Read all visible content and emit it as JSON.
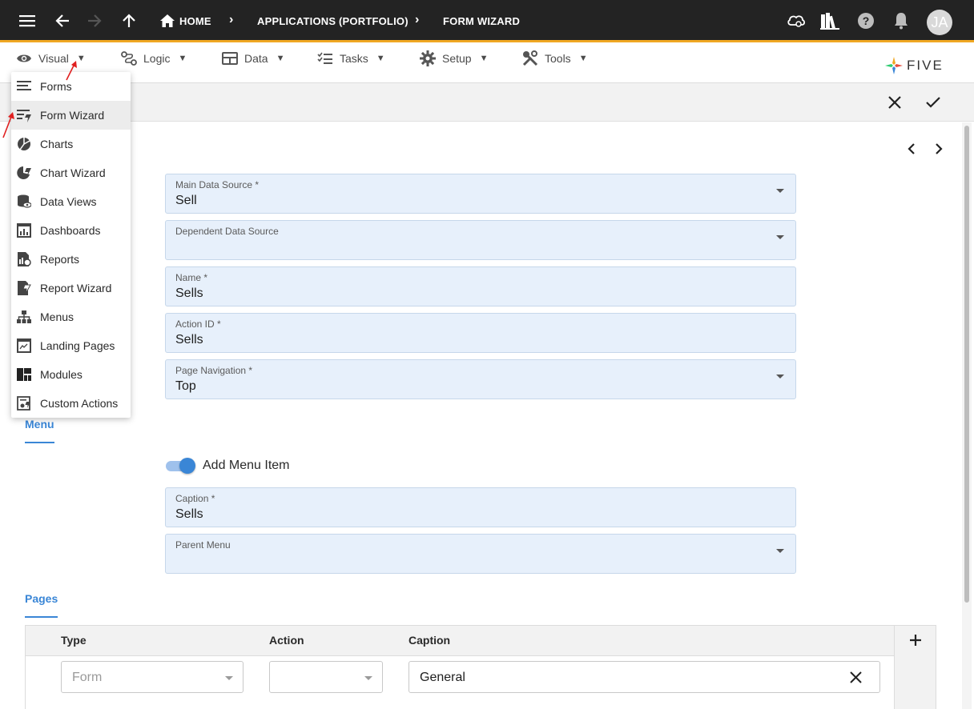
{
  "topbar": {
    "breadcrumbs": [
      "HOME",
      "APPLICATIONS (PORTFOLIO)",
      "FORM WIZARD"
    ],
    "avatar_initials": "JA",
    "icons": [
      "menu-icon",
      "back-arrow-icon",
      "forward-arrow-icon",
      "up-arrow-icon",
      "home-icon",
      "cloud-icon",
      "library-icon",
      "help-icon",
      "notifications-icon"
    ],
    "accent_color": "#f0a823"
  },
  "menubar": {
    "items": [
      {
        "label": "Visual",
        "icon": "eye-icon"
      },
      {
        "label": "Logic",
        "icon": "logic-icon"
      },
      {
        "label": "Data",
        "icon": "table-icon"
      },
      {
        "label": "Tasks",
        "icon": "checklist-icon"
      },
      {
        "label": "Setup",
        "icon": "gear-icon"
      },
      {
        "label": "Tools",
        "icon": "tools-icon"
      }
    ],
    "logo_text": "FIVE"
  },
  "dropdown": {
    "items": [
      {
        "label": "Forms",
        "icon": "forms-icon"
      },
      {
        "label": "Form Wizard",
        "icon": "form-wizard-icon"
      },
      {
        "label": "Charts",
        "icon": "chart-icon"
      },
      {
        "label": "Chart Wizard",
        "icon": "chart-wizard-icon"
      },
      {
        "label": "Data Views",
        "icon": "data-views-icon"
      },
      {
        "label": "Dashboards",
        "icon": "dashboard-icon"
      },
      {
        "label": "Reports",
        "icon": "report-icon"
      },
      {
        "label": "Report Wizard",
        "icon": "report-wizard-icon"
      },
      {
        "label": "Menus",
        "icon": "menus-icon"
      },
      {
        "label": "Landing Pages",
        "icon": "landing-page-icon"
      },
      {
        "label": "Modules",
        "icon": "modules-icon"
      },
      {
        "label": "Custom Actions",
        "icon": "custom-actions-icon"
      }
    ],
    "selected": "Form Wizard"
  },
  "form": {
    "fields": [
      {
        "label": "Main Data Source *",
        "value": "Sell",
        "type": "select"
      },
      {
        "label": "Dependent Data Source",
        "value": "",
        "type": "select"
      },
      {
        "label": "Name *",
        "value": "Sells",
        "type": "text"
      },
      {
        "label": "Action ID *",
        "value": "Sells",
        "type": "text"
      },
      {
        "label": "Page Navigation *",
        "value": "Top",
        "type": "select"
      }
    ],
    "menu_section": {
      "tab_label": "Menu",
      "toggle_label": "Add Menu Item",
      "toggle_on": true,
      "caption": {
        "label": "Caption *",
        "value": "Sells"
      },
      "parent_menu": {
        "label": "Parent Menu",
        "value": ""
      }
    },
    "pages_section": {
      "tab_label": "Pages",
      "columns": [
        "Type",
        "Action",
        "Caption"
      ],
      "rows": [
        {
          "type_placeholder": "Form",
          "action": "",
          "caption": "General"
        }
      ]
    }
  },
  "colors": {
    "field_background": "#e7f0fb",
    "tab_accent": "#3a86d6"
  }
}
